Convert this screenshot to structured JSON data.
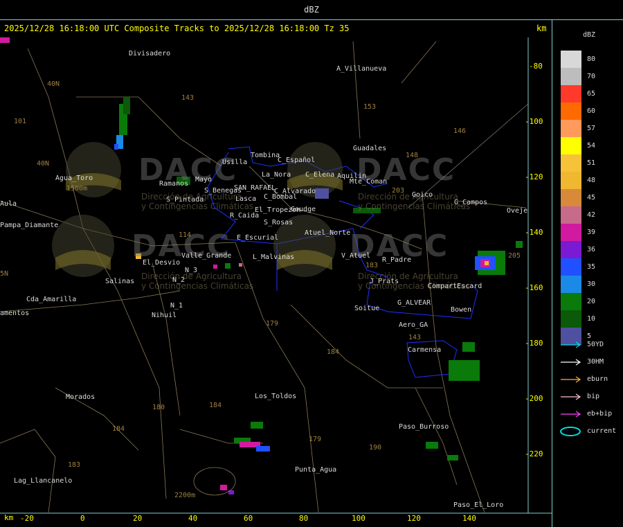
{
  "header": {
    "title": "dBZ"
  },
  "track_title": "2025/12/28 16:18:00 UTC Composite Tracks to 2025/12/28 16:18:00 Tz 35",
  "km_label": "km",
  "x_ticks": [
    "-20",
    "0",
    "20",
    "40",
    "60",
    "80",
    "100",
    "120",
    "140"
  ],
  "y_ticks": [
    "-80",
    "-100",
    "-120",
    "-140",
    "-160",
    "-180",
    "-200",
    "-220"
  ],
  "legend": {
    "title": "dBZ",
    "levels": [
      {
        "label": "80",
        "color": "#d8d8d8"
      },
      {
        "label": "70",
        "color": "#bdbdbd"
      },
      {
        "label": "65",
        "color": "#ff3a2a"
      },
      {
        "label": "60",
        "color": "#ff6a00"
      },
      {
        "label": "57",
        "color": "#ff9a5a"
      },
      {
        "label": "54",
        "color": "#ffff00"
      },
      {
        "label": "51",
        "color": "#f6c23a"
      },
      {
        "label": "48",
        "color": "#f0b830"
      },
      {
        "label": "45",
        "color": "#d88a3a"
      },
      {
        "label": "42",
        "color": "#c86a8a"
      },
      {
        "label": "39",
        "color": "#d21aa0"
      },
      {
        "label": "36",
        "color": "#7a1ad2"
      },
      {
        "label": "35",
        "color": "#2050ff"
      },
      {
        "label": "30",
        "color": "#1a8ae6"
      },
      {
        "label": "20",
        "color": "#0a7a0a"
      },
      {
        "label": "10",
        "color": "#0a5a0a"
      },
      {
        "label": "5",
        "color": "#5050a0"
      }
    ],
    "tracks": [
      {
        "label": "50YD",
        "color": "#00e0e0"
      },
      {
        "label": "30HM",
        "color": "#ffffff"
      },
      {
        "label": "eburn",
        "color": "#ffb040"
      },
      {
        "label": "bip",
        "color": "#ffc0d0"
      },
      {
        "label": "eb+bip",
        "color": "#ff40ff"
      },
      {
        "label": "current",
        "color": "#00e0e0"
      }
    ]
  },
  "places": [
    "Divisadero",
    "A_Villanueva",
    "Tombina",
    "Usilla",
    "C_Español",
    "La_Nora",
    "C_Elena",
    "Aquilin",
    "Mte_Coman",
    "Guadales",
    "Agua_Toro",
    "Ramanos",
    "S_Pintada",
    "Mayo",
    "S_Benegas",
    "SAN_RAFAEL",
    "Lasca",
    "C_Bombal",
    "C_Alvarado",
    "Goico",
    "G_Campos",
    "Oveje",
    "Pampa_Diamante",
    "R_Caida",
    "El_Tropezon",
    "Goudge",
    "S_Rosas",
    "Atuel_Norte",
    "E_Escurial",
    "El_Desvio",
    "Valle_Grande",
    "L_Malvinas",
    "V_Atuel",
    "R_Padre",
    "J_Prats",
    "CompartEscard",
    "Salinas",
    "N_3",
    "N_2",
    "N_1",
    "Cda_Amarilla",
    "Nihuil",
    "G_ALVEAR",
    "Bowen",
    "Soitue",
    "Aero_GA",
    "Carmensa",
    "Morados",
    "Los_Toldos",
    "Paso_Burroso",
    "Lag_Llancanelo",
    "Punta_Agua",
    "Paso_El_Loro",
    "Aula",
    "amentos"
  ],
  "elevations": [
    "153",
    "143",
    "146",
    "148",
    "183",
    "203",
    "40N",
    "40N",
    "101",
    "1500m",
    "114",
    "179",
    "184",
    "180",
    "184",
    "183",
    "179",
    "190",
    "143",
    "205",
    "2200m",
    "5N",
    "N"
  ],
  "watermark": {
    "text": "DACC",
    "line1": "Dirección de Agricultura",
    "line2": "y Contingencias Climáticas"
  }
}
